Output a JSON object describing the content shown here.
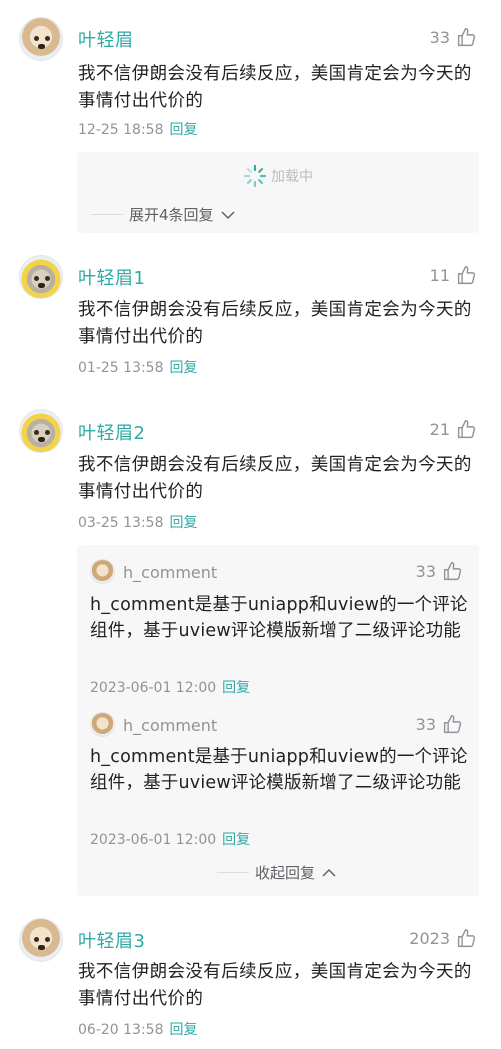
{
  "colors": {
    "accent": "#2eaaa5",
    "muted": "#909399",
    "text": "#222222",
    "sub_bg": "#f7f7f7"
  },
  "comments": [
    {
      "name": "叶轻眉",
      "likes": "33",
      "content": "我不信伊朗会没有后续反应，美国肯定会为今天的事情付出代价的",
      "date": "12-25 18:58",
      "reply_label": "回复",
      "loading_text": "加载中",
      "expand_label": "展开4条回复",
      "avatar_icon": "dog-avatar-icon"
    },
    {
      "name": "叶轻眉1",
      "likes": "11",
      "content": "我不信伊朗会没有后续反应，美国肯定会为今天的事情付出代价的",
      "date": "01-25 13:58",
      "reply_label": "回复",
      "avatar_icon": "dog-avatar-icon"
    },
    {
      "name": "叶轻眉2",
      "likes": "21",
      "content": "我不信伊朗会没有后续反应，美国肯定会为今天的事情付出代价的",
      "date": "03-25 13:58",
      "reply_label": "回复",
      "avatar_icon": "dog-avatar-icon",
      "replies": [
        {
          "name": "h_comment",
          "likes": "33",
          "content": "h_comment是基于uniapp和uview的一个评论组件，基于uview评论模版新增了二级评论功能",
          "date": "2023-06-01 12:00",
          "reply_label": "回复"
        },
        {
          "name": "h_comment",
          "likes": "33",
          "content": "h_comment是基于uniapp和uview的一个评论组件，基于uview评论模版新增了二级评论功能",
          "date": "2023-06-01 12:00",
          "reply_label": "回复"
        }
      ],
      "collapse_label": "收起回复"
    },
    {
      "name": "叶轻眉3",
      "likes": "2023",
      "content": "我不信伊朗会没有后续反应，美国肯定会为今天的事情付出代价的",
      "date": "06-20 13:58",
      "reply_label": "回复",
      "avatar_icon": "dog-avatar-icon"
    }
  ]
}
